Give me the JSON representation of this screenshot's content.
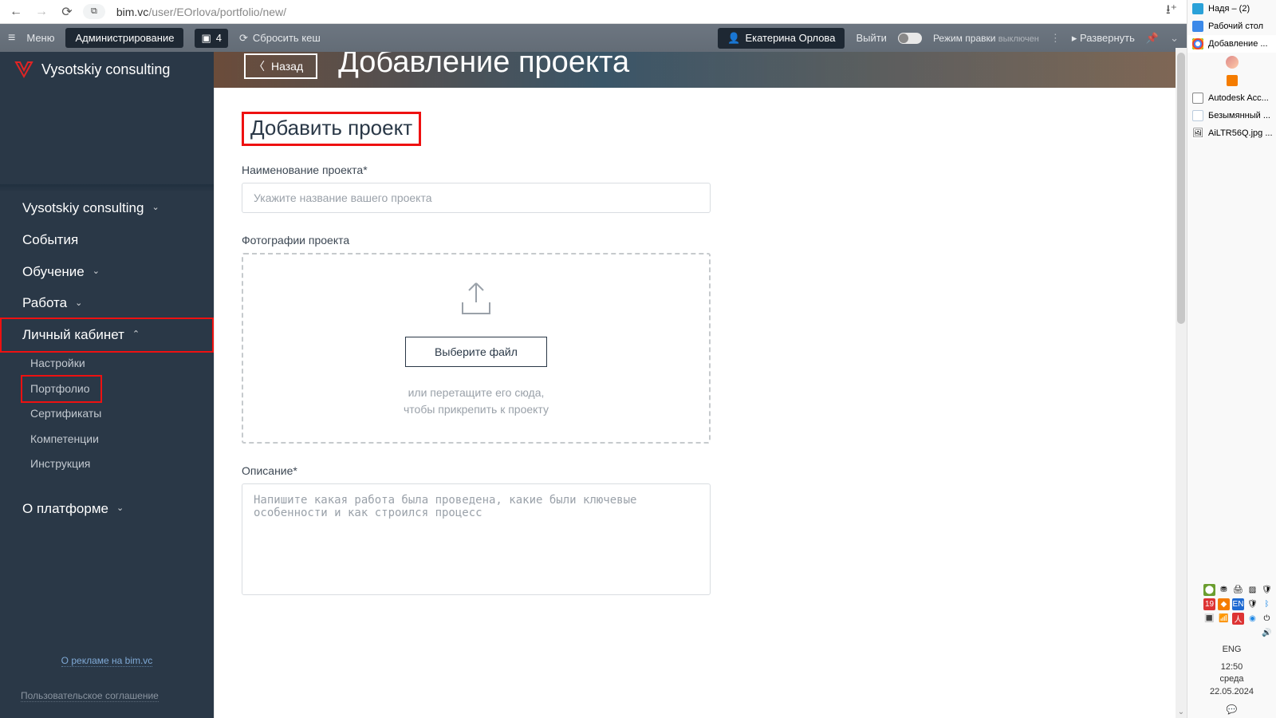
{
  "browser": {
    "url_domain": "bim.vc",
    "url_path": "/user/EOrlova/portfolio/new/",
    "site_chip": "⧉"
  },
  "right_tabs": [
    {
      "label": "Надя – (2)",
      "fav": "f-telegram"
    },
    {
      "label": "Рабочий стол",
      "fav": "f-desk"
    },
    {
      "label": "Добавление ...",
      "fav": "f-chrome",
      "active": true
    },
    {
      "label": "",
      "fav": "avatar"
    },
    {
      "label": "",
      "fav": "f-orange"
    },
    {
      "label": "Autodesk Acc...",
      "fav": "f-auto"
    },
    {
      "label": "Безымянный ...",
      "fav": "f-doc"
    },
    {
      "label": "AiLTR56Q.jpg ...",
      "fav": "f-img"
    }
  ],
  "clock": {
    "lang": "ENG",
    "time": "12:50",
    "day": "среда",
    "date": "22.05.2024"
  },
  "admin": {
    "menu": "Меню",
    "admin_btn": "Администрирование",
    "badge_count": "4",
    "reset_cache": "Сбросить кеш",
    "user": "Екатерина Орлова",
    "logout": "Выйти",
    "mode_label": "Режим правки",
    "mode_state": "выключен",
    "expand": "Развернуть"
  },
  "brand": "Vysotskiy consulting",
  "nav": {
    "top": "Vysotskiy consulting",
    "items": [
      "События",
      "Обучение",
      "Работа",
      "Личный кабинет"
    ],
    "sub": [
      "Настройки",
      "Портфолио",
      "Сертификаты",
      "Компетенции",
      "Инструкция"
    ],
    "about": "О платформе",
    "ad_link": "О рекламе на bim.vc",
    "ua": "Пользовательское соглашение"
  },
  "hero": {
    "back": "Назад",
    "title": "Добавление проекта"
  },
  "form": {
    "heading": "Добавить проект",
    "name_label": "Наименование проекта*",
    "name_placeholder": "Укажите название вашего проекта",
    "photos_label": "Фотографии проекта",
    "choose_file": "Выберите файл",
    "drag_l1": "или перетащите его сюда,",
    "drag_l2": "чтобы прикрепить к проекту",
    "desc_label": "Описание*",
    "desc_placeholder": "Напишите какая работа была проведена, какие были ключевые особенности и как строился процесс"
  }
}
